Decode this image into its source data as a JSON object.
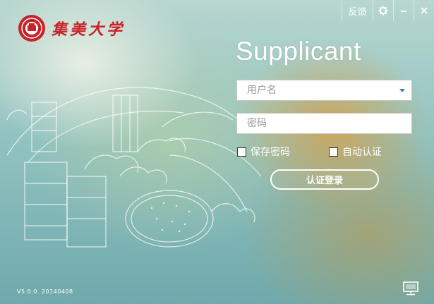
{
  "window": {
    "feedback_label": "反馈",
    "settings_icon": "gear-icon",
    "minimize_icon": "minimize-icon",
    "close_icon": "close-icon"
  },
  "logo": {
    "name": "集美大学",
    "seal_icon": "university-seal-icon"
  },
  "app_title": "Supplicant",
  "username": {
    "placeholder": "用户名",
    "value": ""
  },
  "password": {
    "placeholder": "密码",
    "value": ""
  },
  "options": {
    "save_password_label": "保存密码",
    "save_password_checked": false,
    "auto_auth_label": "自动认证",
    "auto_auth_checked": false
  },
  "login_button_label": "认证登录",
  "version": "V5.0.0. 20140408",
  "network_icon": "network-status-icon",
  "colors": {
    "brand_red": "#c8232a",
    "accent_blue": "#3f7fb8",
    "background_teal": "#92c3c0",
    "background_amber": "#d6a04a"
  }
}
